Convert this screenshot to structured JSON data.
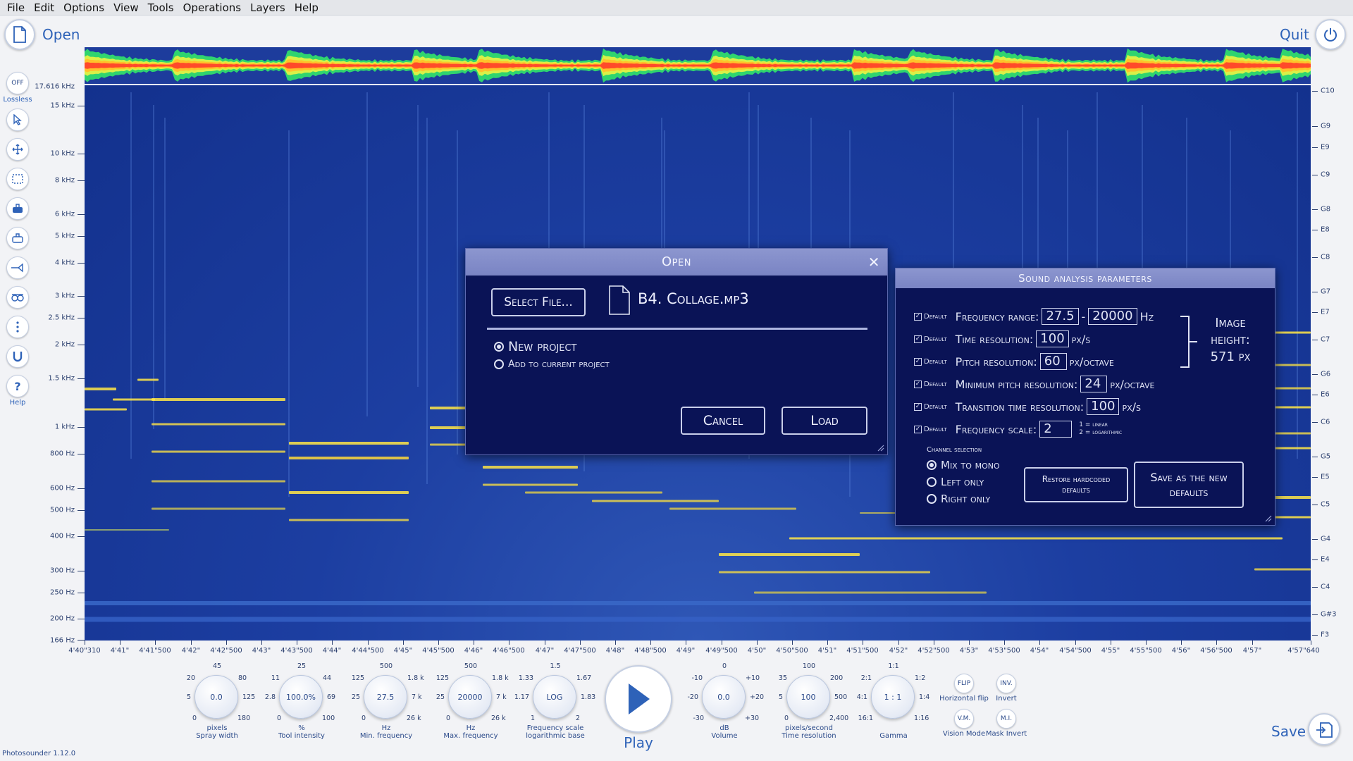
{
  "menu": [
    "File",
    "Edit",
    "Options",
    "View",
    "Tools",
    "Operations",
    "Layers",
    "Help"
  ],
  "topbar": {
    "open_label": "Open",
    "quit_label": "Quit"
  },
  "toolbar": {
    "lossless_button": "OFF",
    "lossless_label": "Lossless",
    "help_label": "Help"
  },
  "spectrogram": {
    "top_freq": "17.616 kHz",
    "freq_labels": [
      "15 kHz",
      "10 kHz",
      "8 kHz",
      "6 kHz",
      "5 kHz",
      "4 kHz",
      "3 kHz",
      "2.5 kHz",
      "2 kHz",
      "1.5 kHz",
      "1 kHz",
      "800 Hz",
      "600 Hz",
      "500 Hz",
      "400 Hz",
      "300 Hz",
      "250 Hz",
      "200 Hz",
      "166 Hz"
    ],
    "note_labels": [
      "C10",
      "G9",
      "E9",
      "C9",
      "G8",
      "E8",
      "C8",
      "G7",
      "E7",
      "C7",
      "G6",
      "E6",
      "C6",
      "G5",
      "E5",
      "C5",
      "G4",
      "E4",
      "C4",
      "G#3",
      "F3"
    ],
    "time_labels": [
      "4'40\"310",
      "4'41\"",
      "4'41\"500",
      "4'42\"",
      "4'42\"500",
      "4'43\"",
      "4'43\"500",
      "4'44\"",
      "4'44\"500",
      "4'45\"",
      "4'45\"500",
      "4'46\"",
      "4'46\"500",
      "4'47\"",
      "4'47\"500",
      "4'48\"",
      "4'48\"500",
      "4'49\"",
      "4'49\"500",
      "4'50\"",
      "4'50\"500",
      "4'51\"",
      "4'51\"500",
      "4'52\"",
      "4'52\"500",
      "4'53\"",
      "4'53\"500",
      "4'54\"",
      "4'54\"500",
      "4'55\"",
      "4'55\"500",
      "4'56\"",
      "4'56\"500",
      "4'57\"",
      "4'57\"640"
    ]
  },
  "open_dialog": {
    "title": "Open",
    "close": "✕",
    "select_file": "Select File...",
    "file_name": "B4. Collage.mp3",
    "options": [
      "New project",
      "Add to current project"
    ],
    "cancel": "Cancel",
    "load": "Load"
  },
  "params_dialog": {
    "title": "Sound analysis parameters",
    "default_label": "Default",
    "freq_range_label": "Frequency range:",
    "freq_min": "27.5",
    "freq_sep": "-",
    "freq_max": "20000",
    "freq_unit": "Hz",
    "time_res_label": "Time resolution:",
    "time_res": "100",
    "time_res_unit": "px/s",
    "pitch_res_label": "Pitch resolution:",
    "pitch_res": "60",
    "pitch_res_unit": "px/octave",
    "min_pitch_label": "Minimum pitch resolution:",
    "min_pitch": "24",
    "min_pitch_unit": "px/octave",
    "trans_label": "Transition time resolution:",
    "trans": "100",
    "trans_unit": "px/s",
    "scale_label": "Frequency scale:",
    "scale": "2",
    "scale_note1": "1 = linear",
    "scale_note2": "2 = logarithmic",
    "image_height_1": "Image",
    "image_height_2": "height:",
    "image_height_3": "571 px",
    "channel_title": "Channel selection",
    "channels": [
      "Mix to mono",
      "Left only",
      "Right only"
    ],
    "restore": "Restore hardcoded defaults",
    "save_defaults": "Save as the new defaults"
  },
  "knobs": [
    {
      "value": "0.0",
      "top": "45",
      "tl": "20",
      "tr": "80",
      "ml": "5",
      "mr": "125",
      "bl": "0",
      "br": "180",
      "unit": "pixels",
      "name": "Spray width"
    },
    {
      "value": "100.0%",
      "top": "25",
      "tl": "11",
      "tr": "44",
      "ml": "2.8",
      "mr": "69",
      "bl": "0",
      "br": "100",
      "unit": "%",
      "name": "Tool intensity"
    },
    {
      "value": "27.5",
      "top": "500",
      "tl": "125",
      "tr": "1.8 k",
      "ml": "25",
      "mr": "7 k",
      "bl": "0",
      "br": "26 k",
      "unit": "Hz",
      "name": "Min. frequency"
    },
    {
      "value": "20000",
      "top": "500",
      "tl": "125",
      "tr": "1.8 k",
      "ml": "25",
      "mr": "7 k",
      "bl": "0",
      "br": "26 k",
      "unit": "Hz",
      "name": "Max. frequency"
    },
    {
      "value": "LOG",
      "top": "1.5",
      "tl": "1.33",
      "tr": "1.67",
      "ml": "1.17",
      "mr": "1.83",
      "bl": "1",
      "br": "2",
      "unit": "Frequency scale",
      "name": "logarithmic base"
    },
    {
      "value": "0.0",
      "top": "0",
      "tl": "-10",
      "tr": "+10",
      "ml": "-20",
      "mr": "+20",
      "bl": "-30",
      "br": "+30",
      "unit": "dB",
      "name": "Volume"
    },
    {
      "value": "100",
      "top": "100",
      "tl": "35",
      "tr": "200",
      "ml": "5",
      "mr": "500",
      "bl": "0",
      "br": "2,400",
      "unit": "pixels/second",
      "name": "Time resolution"
    },
    {
      "value": "1 : 1",
      "top": "1:1",
      "tl": "2:1",
      "tr": "1:2",
      "ml": "4:1",
      "mr": "1:4",
      "bl": "16:1",
      "br": "1:16",
      "unit": "",
      "name": "Gamma"
    }
  ],
  "small_buttons": [
    {
      "btn": "FLIP",
      "label": "Horizontal flip"
    },
    {
      "btn": "INV.",
      "label": "Invert"
    },
    {
      "btn": "V.M.",
      "label": "Vision Mode"
    },
    {
      "btn": "M.I.",
      "label": "Mask Invert"
    }
  ],
  "play_label": "Play",
  "save_label": "Save",
  "version": "Photosounder 1.12.0",
  "colors": {
    "spectrum_bg": "#1c3ea1",
    "dialog_bg": "#0a1356",
    "dialog_title": "#8c96cf",
    "accent": "#2e62b8",
    "harmonic": "#ffe646"
  }
}
